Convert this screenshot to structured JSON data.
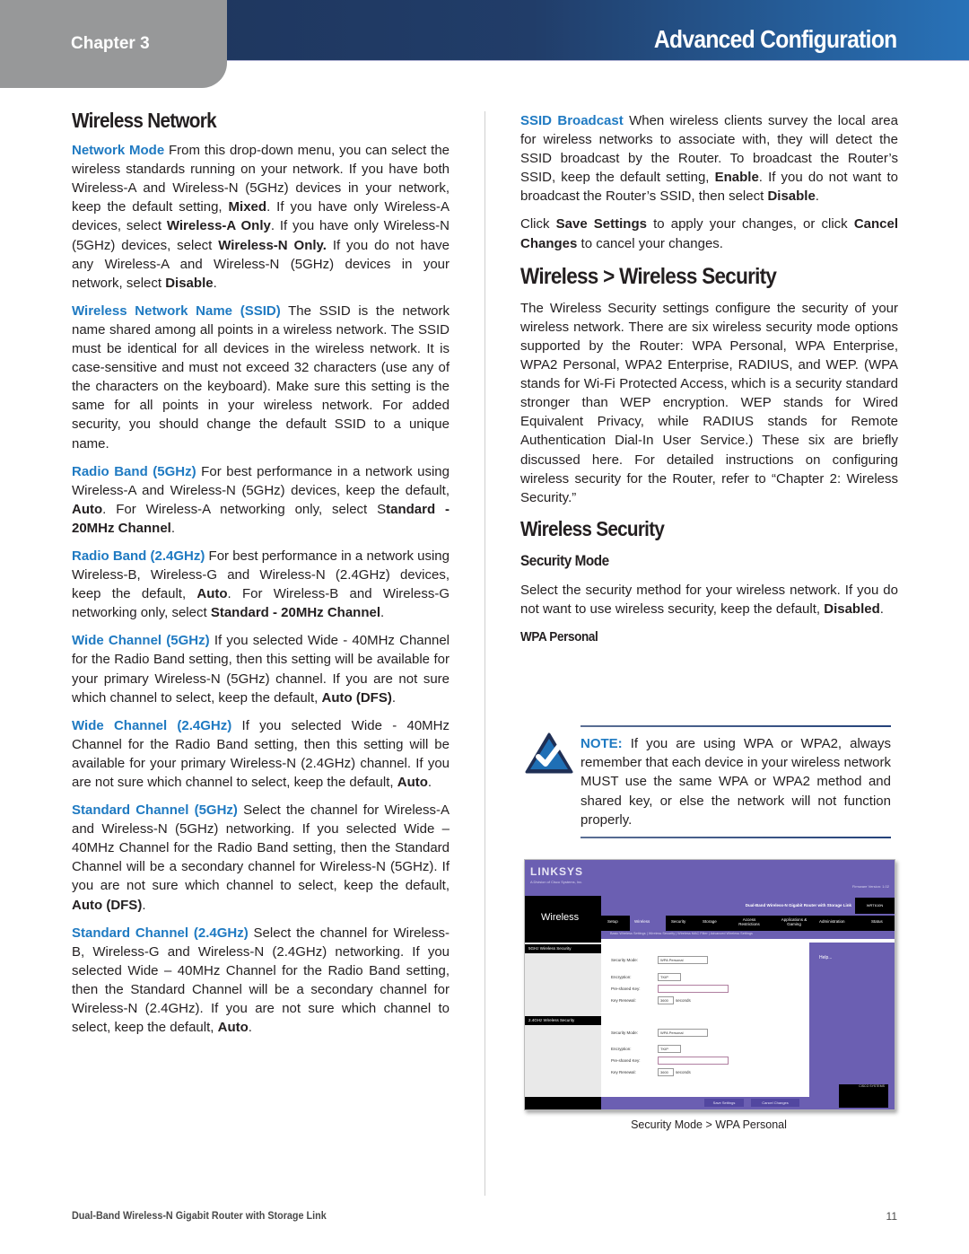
{
  "header": {
    "chapter": "Chapter 3",
    "title": "Advanced Configuration",
    "colors": {
      "header_dark": "#1d3359",
      "header_light": "#2872b8",
      "chapter_tab": "#979899",
      "accent": "#1f7ac2"
    }
  },
  "left_column": {
    "heading": "Wireless Network",
    "paragraphs": [
      {
        "lead": "Network Mode",
        "segments": [
          {
            "t": " From this drop-down menu, you can select the wireless standards running on your network. If you have both Wireless-A and Wireless-N (5GHz) devices in your network, keep the default setting, "
          },
          {
            "b": "Mixed"
          },
          {
            "t": ". If you have only Wireless-A devices, select "
          },
          {
            "b": "Wireless-A Only"
          },
          {
            "t": ". If you have only Wireless-N (5GHz) devices, select "
          },
          {
            "b": "Wireless-N Only."
          },
          {
            "t": " If you do not have any Wireless-A and Wireless-N (5GHz) devices in your network, select "
          },
          {
            "b": "Disable"
          },
          {
            "t": "."
          }
        ]
      },
      {
        "lead": "Wireless Network Name (SSID)",
        "segments": [
          {
            "t": "  The SSID is the network name shared among all points in a wireless network. The SSID must be identical for all devices in the wireless network. It is case-sensitive and must not exceed 32 characters (use any of the characters on the keyboard). Make sure this setting is the same for all points in your wireless network. For added security, you should change the default SSID to a unique name."
          }
        ]
      },
      {
        "lead": "Radio Band (5GHz)",
        "segments": [
          {
            "t": "  For best performance in a network using Wireless-A and Wireless-N (5GHz) devices, keep the default, "
          },
          {
            "b": "Auto"
          },
          {
            "t": ". For Wireless-A networking only, select S"
          },
          {
            "b": "tandard - 20MHz Channel"
          },
          {
            "t": "."
          }
        ]
      },
      {
        "lead": "Radio Band (2.4GHz)",
        "segments": [
          {
            "t": "  For best performance in a network using Wireless-B, Wireless-G and Wireless-N (2.4GHz) devices, keep the default, "
          },
          {
            "b": "Auto"
          },
          {
            "t": ". For Wireless-B and Wireless-G networking only, select "
          },
          {
            "b": "Standard - 20MHz Channel"
          },
          {
            "t": "."
          }
        ]
      },
      {
        "lead": "Wide Channel (5GHz)",
        "segments": [
          {
            "t": "  If you selected Wide - 40MHz Channel for the Radio Band setting, then this setting will be available for your primary Wireless-N (5GHz) channel. If you are not sure which channel to select, keep the default, "
          },
          {
            "b": "Auto (DFS)"
          },
          {
            "t": "."
          }
        ]
      },
      {
        "lead": "Wide Channel (2.4GHz)",
        "segments": [
          {
            "t": "  If you selected Wide - 40MHz Channel for the Radio Band setting, then this setting will be available for your primary Wireless-N (2.4GHz) channel. If you are not sure which channel to select, keep the default, "
          },
          {
            "b": "Auto"
          },
          {
            "t": "."
          }
        ]
      },
      {
        "lead": "Standard Channel (5GHz)",
        "segments": [
          {
            "t": " Select the channel for Wireless-A and Wireless-N (5GHz) networking. If you selected Wide – 40MHz Channel for the Radio Band setting, then the Standard Channel will be a secondary channel for Wireless-N (5GHz). If you are not sure which channel to select, keep the default, "
          },
          {
            "b": "Auto (DFS)"
          },
          {
            "t": "."
          }
        ]
      },
      {
        "lead": "Standard Channel (2.4GHz)",
        "segments": [
          {
            "t": " Select the channel for Wireless-B, Wireless-G and Wireless-N (2.4GHz) networking. If you selected Wide – 40MHz Channel for the Radio Band setting, then the Standard Channel will be a secondary channel for Wireless-N (2.4GHz). If you are not sure which channel to select, keep the default, "
          },
          {
            "b": "Auto"
          },
          {
            "t": "."
          }
        ]
      }
    ]
  },
  "right_column": {
    "ssid_paragraph": {
      "lead": "SSID Broadcast",
      "segments": [
        {
          "t": "  When wireless clients survey the local area for wireless networks to associate with, they will detect the SSID broadcast by the Router. To broadcast the Router’s SSID, keep the default setting, "
        },
        {
          "b": "Enable"
        },
        {
          "t": ". If you do not want to broadcast the Router’s SSID, then select "
        },
        {
          "b": "Disable"
        },
        {
          "t": "."
        }
      ]
    },
    "save_paragraph": {
      "segments": [
        {
          "t": "Click "
        },
        {
          "b": "Save Settings"
        },
        {
          "t": " to apply your changes, or click "
        },
        {
          "b": "Cancel Changes"
        },
        {
          "t": " to cancel your changes."
        }
      ]
    },
    "section_heading": "Wireless > Wireless Security",
    "section_intro": "The Wireless Security settings configure the security of your wireless network. There are six wireless security mode options supported by the Router: WPA Personal, WPA Enterprise, WPA2 Personal, WPA2 Enterprise, RADIUS, and WEP. (WPA stands for Wi-Fi Protected Access, which is a security standard stronger than WEP encryption. WEP stands for Wired Equivalent Privacy, while RADIUS stands for Remote Authentication Dial-In User Service.) These six are briefly discussed here. For detailed instructions on configuring wireless security for the Router, refer to “Chapter 2: Wireless Security.”",
    "subheading": "Wireless Security",
    "security_mode_heading": "Security Mode",
    "security_mode_paragraph": {
      "segments": [
        {
          "t": "Select the security method for your wireless network. If you do not want to use wireless security, keep the default, "
        },
        {
          "b": "Disabled"
        },
        {
          "t": "."
        }
      ]
    },
    "wpa_heading": "WPA Personal",
    "note": {
      "label": "NOTE:",
      "text": " If you are using WPA or WPA2, always remember that each device in your wireless network MUST use the same WPA or WPA2 method and shared key, or else the network will not function properly.",
      "icon": "checkmark-icon"
    }
  },
  "screenshot": {
    "logo": "LINKSYS",
    "logo_sub": "A Division of Cisco Systems, Inc.",
    "firmware": "Firmware Version: 1.02",
    "product": "Dual-Band Wireless-N Gigabit Router with Storage Link",
    "model": "WRT610N",
    "section": "Wireless",
    "tabs": [
      "Setup",
      "Wireless",
      "Security",
      "Storage",
      "Access Restrictions",
      "Applications & Gaming",
      "Administration",
      "Status"
    ],
    "active_tab": "Wireless",
    "subtabs": "Basic Wireless Settings  |  Wireless Security  |  Wireless MAC Filter  |  Advanced Wireless Settings",
    "band5_label": "5GHz Wireless Security",
    "band24_label": "2.4GHz Wireless Security",
    "fields": {
      "security_mode_label": "Security Mode:",
      "security_mode_value": "WPA Personal",
      "encryption_label": "Encryption:",
      "encryption_value": "TKIP",
      "psk_label": "Pre-shared Key:",
      "psk_value": "",
      "key_renewal_label": "Key Renewal:",
      "key_renewal_value": "3600",
      "key_renewal_unit": "seconds"
    },
    "help": "Help...",
    "save_button": "Save Settings",
    "cancel_button": "Cancel Changes",
    "cisco": "CISCO SYSTEMS",
    "caption": "Security Mode > WPA Personal"
  },
  "footer": {
    "title": "Dual-Band Wireless-N Gigabit Router with Storage Link",
    "page": "11"
  }
}
